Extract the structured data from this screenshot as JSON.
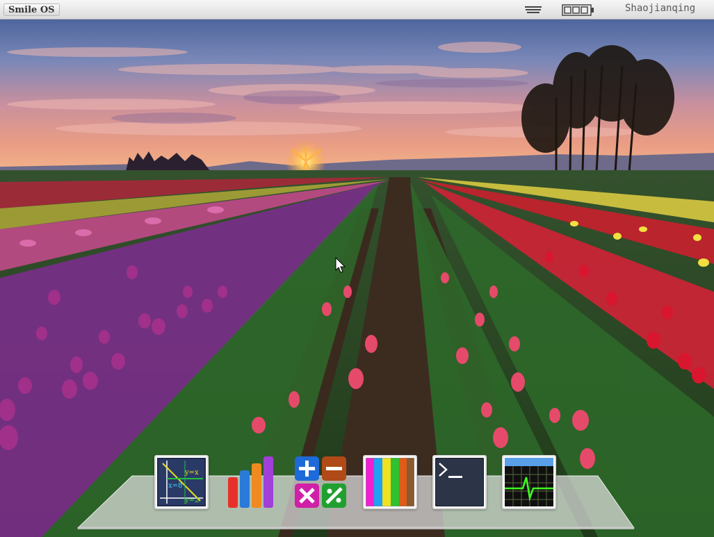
{
  "topbar": {
    "os_name": "Smile OS",
    "username": "Shaojianqing",
    "menu_icon": "menu-lines-icon",
    "battery_icon": "battery-icon"
  },
  "dock": {
    "items": [
      {
        "name": "math-plot-app",
        "icon": "graph-plot-icon",
        "labels": [
          "y=x",
          "x=8",
          "y=2"
        ]
      },
      {
        "name": "chart-app",
        "icon": "bar-chart-icon"
      },
      {
        "name": "calculator-app",
        "icon": "calculator-icon"
      },
      {
        "name": "palette-app",
        "icon": "color-palette-icon"
      },
      {
        "name": "terminal-app",
        "icon": "terminal-icon"
      },
      {
        "name": "system-monitor-app",
        "icon": "heartbeat-monitor-icon"
      }
    ]
  },
  "colors": {
    "topbar": "#e6e6e6",
    "sky_top": "#3e5a92",
    "sunset": "#f0a070",
    "field_green": "#2f6b2a"
  }
}
